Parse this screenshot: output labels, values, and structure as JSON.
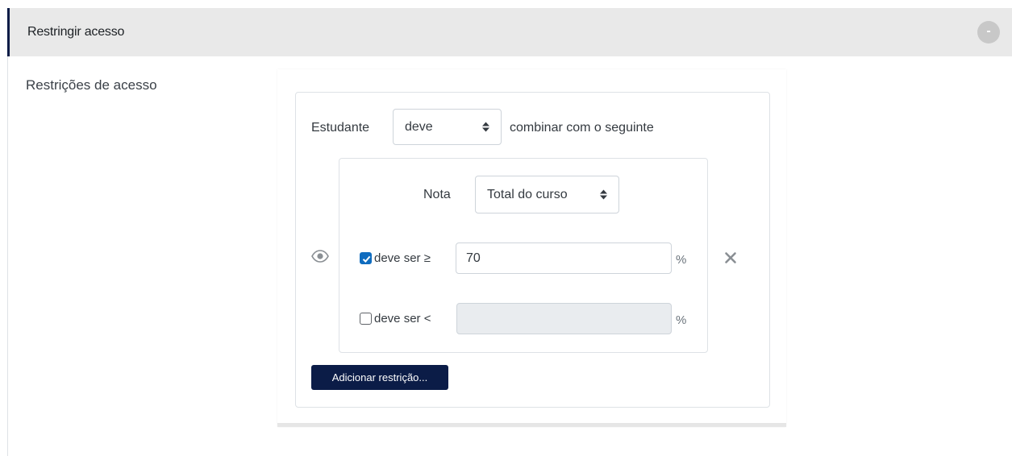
{
  "section": {
    "title": "Restringir acesso",
    "collapse_symbol": "-"
  },
  "field": {
    "label": "Restrições de acesso"
  },
  "restriction_set": {
    "prefix": "Estudante",
    "match_select_value": "deve",
    "suffix": "combinar com o seguinte"
  },
  "condition": {
    "type_label": "Nota",
    "grade_item_value": "Total do curso",
    "min": {
      "checked": true,
      "label": "deve ser ≥",
      "value": "70",
      "unit": "%"
    },
    "max": {
      "checked": false,
      "label": "deve ser <",
      "value": "",
      "unit": "%"
    },
    "remove_symbol": "×"
  },
  "add_button": {
    "label": "Adicionar restrição..."
  },
  "colors": {
    "accent_dark": "#0b1c47",
    "checkbox_blue": "#0f6cbf",
    "header_bg": "#e9e9e9"
  },
  "icons": {
    "visibility": "eye-icon",
    "remove": "close-icon",
    "caret": "sort-caret-icon"
  }
}
